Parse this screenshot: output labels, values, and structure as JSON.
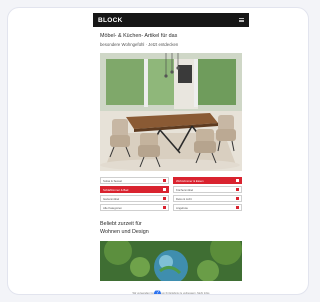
{
  "header": {
    "logo": "BLOCK",
    "menu_icon": "hamburger-menu-icon"
  },
  "page": {
    "title_line1": "Möbel- & Küchen- Artikel für das",
    "title_line2": "besondere Wohngefühl · Jetzt entdecken"
  },
  "hero": {
    "alt": "Moderner Essbereich mit Holztisch und Stühlen"
  },
  "categories": [
    {
      "label": "Sofas & Sessel",
      "active": false
    },
    {
      "label": "Wohnzimmer & Essen",
      "active": true
    },
    {
      "label": "Schlafzimmer & Bad",
      "active": true
    },
    {
      "label": "Küchenmöbel",
      "active": false
    },
    {
      "label": "Gartenmöbel",
      "active": false
    },
    {
      "label": "Deko & Licht",
      "active": false
    },
    {
      "label": "Alle Kategorien",
      "active": false
    },
    {
      "label": "Angebote",
      "active": false
    }
  ],
  "section": {
    "title_line1": "Beliebt zurzeit für",
    "title_line2": "Wohnen und Design"
  },
  "cookie": {
    "text": "Wir verwenden Cookies, um Ihr Erlebnis zu verbessern. Mehr Infos"
  },
  "colors": {
    "accent": "#d9232f",
    "header_bg": "#161616",
    "fab": "#2c73f0"
  },
  "fab": {
    "label": "?"
  }
}
